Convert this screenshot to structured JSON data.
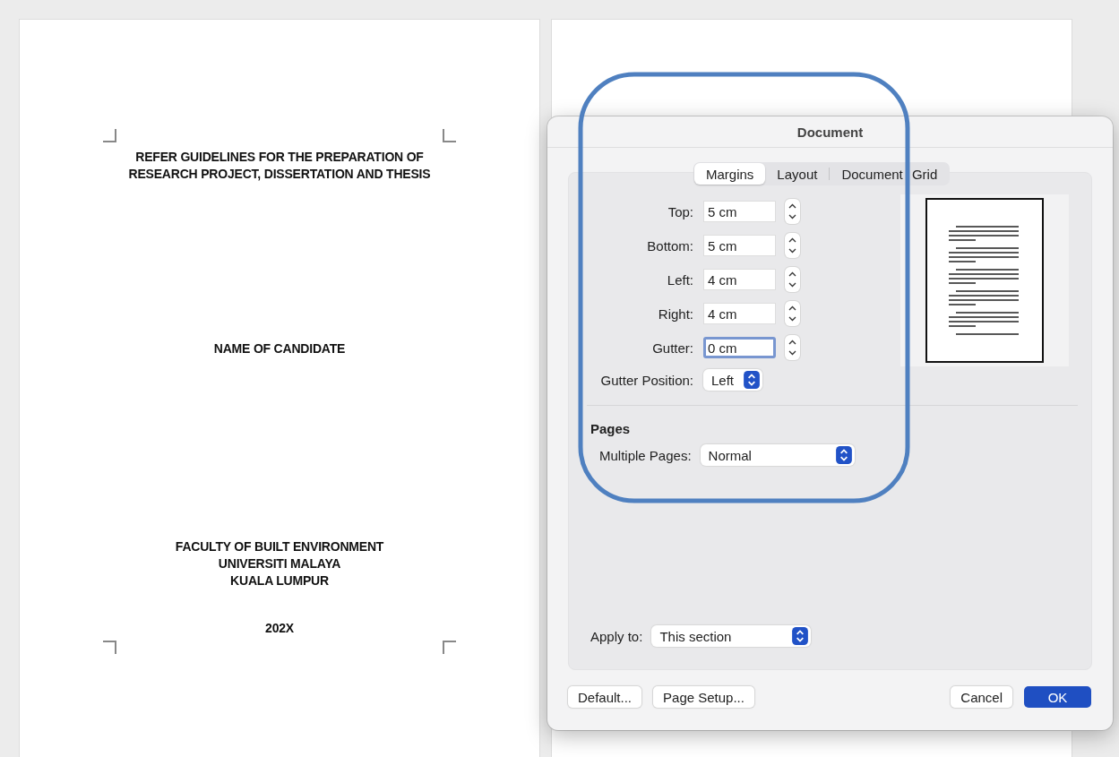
{
  "document_page": {
    "heading_lines": [
      "REFER GUIDELINES FOR THE PREPARATION OF",
      "RESEARCH PROJECT, DISSERTATION AND THESIS"
    ],
    "candidate": "NAME OF CANDIDATE",
    "institution_lines": [
      "FACULTY OF BUILT ENVIRONMENT",
      "UNIVERSITI MALAYA",
      "KUALA LUMPUR"
    ],
    "year": "202X"
  },
  "dialog": {
    "title": "Document",
    "tabs": [
      {
        "label": "Margins",
        "selected": true
      },
      {
        "label": "Layout",
        "selected": false
      },
      {
        "label": "Document Grid",
        "selected": false
      }
    ],
    "margin_fields": [
      {
        "label": "Top:",
        "value": "5 cm",
        "focused": false
      },
      {
        "label": "Bottom:",
        "value": "5 cm",
        "focused": false
      },
      {
        "label": "Left:",
        "value": "4 cm",
        "focused": false
      },
      {
        "label": "Right:",
        "value": "4 cm",
        "focused": false
      },
      {
        "label": "Gutter:",
        "value": "0 cm",
        "focused": true
      }
    ],
    "gutter_position": {
      "label": "Gutter Position:",
      "value": "Left"
    },
    "pages": {
      "heading": "Pages",
      "multiple_pages": {
        "label": "Multiple Pages:",
        "value": "Normal"
      }
    },
    "apply_to": {
      "label": "Apply to:",
      "value": "This section"
    },
    "buttons": [
      {
        "label": "Default...",
        "kind": "secondary"
      },
      {
        "label": "Page Setup...",
        "kind": "secondary"
      },
      {
        "label": "Cancel",
        "kind": "secondary"
      },
      {
        "label": "OK",
        "kind": "primary"
      }
    ]
  }
}
